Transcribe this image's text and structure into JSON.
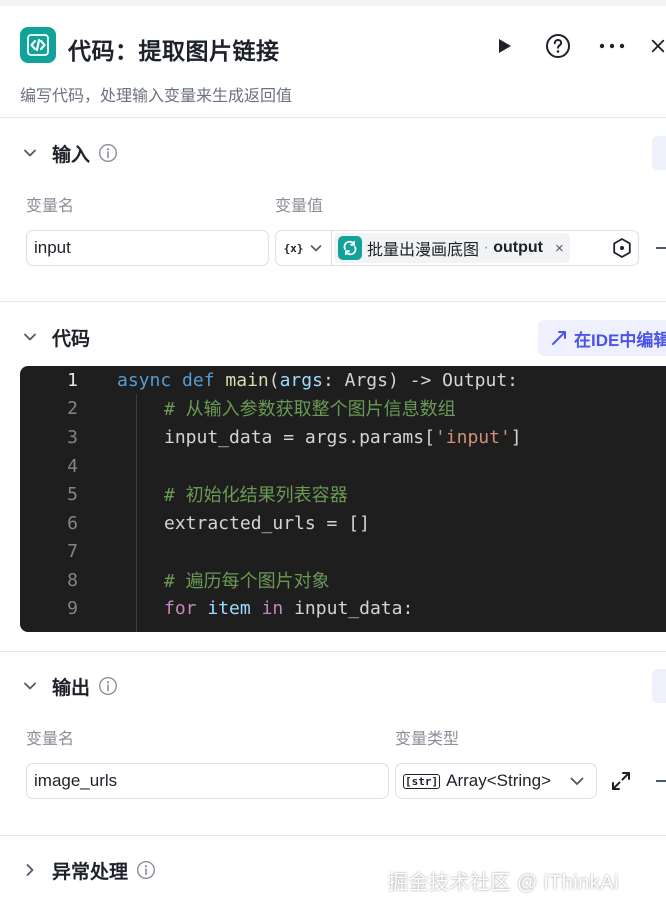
{
  "header": {
    "title": "代码：提取图片链接",
    "description": "编写代码，处理输入变量来生成返回值"
  },
  "input_section": {
    "title": "输入",
    "col_name": "变量名",
    "col_value": "变量值",
    "row": {
      "name": "input",
      "type_glyph": "{x}",
      "ref_node": "批量出漫画底图",
      "ref_sep": " · ",
      "ref_field": "output",
      "remove": "×"
    }
  },
  "code_section": {
    "title": "代码",
    "ide_button": "在IDE中编辑",
    "lines": [
      {
        "n": "1"
      },
      {
        "n": "2"
      },
      {
        "n": "3"
      },
      {
        "n": "4"
      },
      {
        "n": "5"
      },
      {
        "n": "6"
      },
      {
        "n": "7"
      },
      {
        "n": "8"
      },
      {
        "n": "9"
      }
    ],
    "code": {
      "l1_async": "async",
      "l1_def": "def",
      "l1_main": "main",
      "l1_args": "args",
      "l1_rest": ": Args) -> Output:",
      "l2": "# 从输入参数获取整个图片信息数组",
      "l3_a": "input_data = args.params[",
      "l3_str": "'input'",
      "l3_b": "]",
      "l5": "# 初始化结果列表容器",
      "l6": "extracted_urls = []",
      "l8": "# 遍历每个图片对象",
      "l9_for": "for",
      "l9_item": "item",
      "l9_in": "in",
      "l9_rest": "input_data:"
    }
  },
  "output_section": {
    "title": "输出",
    "col_name": "变量名",
    "col_type": "变量类型",
    "row": {
      "name": "image_urls",
      "type_glyph": "[str]",
      "type": "Array<String>"
    }
  },
  "error_section": {
    "title": "异常处理"
  },
  "watermark": "掘金技术社区 @ iThinkAi",
  "colors": {
    "accent_teal": "#10a39a",
    "accent_purple": "#4d53e8",
    "editor_bg": "#1e1e1e"
  },
  "icons": [
    "code-node-icon",
    "play-icon",
    "help-icon",
    "more-icon",
    "close-icon",
    "chevron-down-icon",
    "info-icon",
    "loop-icon",
    "target-icon",
    "expand-icon",
    "external-edit-icon"
  ]
}
